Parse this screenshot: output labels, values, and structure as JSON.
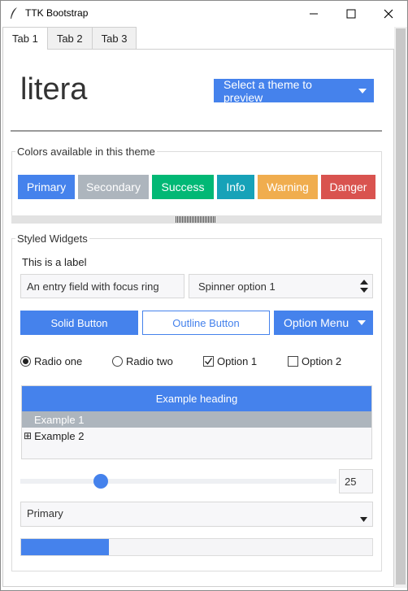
{
  "window": {
    "title": "TTK Bootstrap"
  },
  "tabs": [
    {
      "label": "Tab 1",
      "active": true
    },
    {
      "label": "Tab 2",
      "active": false
    },
    {
      "label": "Tab 3",
      "active": false
    }
  ],
  "header": {
    "theme_name": "litera",
    "theme_select_label": "Select a theme to preview"
  },
  "colors_group": {
    "title": "Colors available in this theme",
    "buttons": [
      {
        "label": "Primary",
        "color": "#4582ec"
      },
      {
        "label": "Secondary",
        "color": "#adb5bd"
      },
      {
        "label": "Success",
        "color": "#02b875"
      },
      {
        "label": "Info",
        "color": "#17a2b8"
      },
      {
        "label": "Warning",
        "color": "#f0ad4e"
      },
      {
        "label": "Danger",
        "color": "#d9534f"
      }
    ]
  },
  "widgets_group": {
    "title": "Styled Widgets",
    "label": "This is a label",
    "entry_value": "An entry field with focus ring",
    "spinner_value": "Spinner option 1",
    "solid_button": "Solid Button",
    "outline_button": "Outline Button",
    "option_menu": "Option Menu",
    "radios": [
      {
        "label": "Radio one",
        "selected": true
      },
      {
        "label": "Radio two",
        "selected": false
      }
    ],
    "checks": [
      {
        "label": "Option 1",
        "checked": true
      },
      {
        "label": "Option 2",
        "checked": false
      }
    ],
    "tree": {
      "heading": "Example heading",
      "rows": [
        {
          "label": "Example 1",
          "selected": true
        },
        {
          "label": "Example 2",
          "selected": false,
          "expander": "⊞"
        }
      ]
    },
    "scale_value": "25",
    "scale_fraction": 0.25,
    "combobox_value": "Primary",
    "progress_fraction": 0.25
  },
  "accent": "#4582ec"
}
